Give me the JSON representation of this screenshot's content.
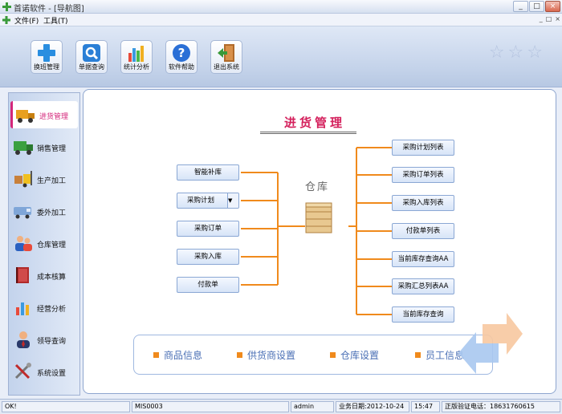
{
  "window": {
    "title": "首诺软件 - [导航图]",
    "minimize": "_",
    "maximize": "□",
    "close": "×"
  },
  "menubar": {
    "file": "文件(F)",
    "tools": "工具(T)",
    "mdi_buttons": [
      "_",
      "□",
      "×"
    ]
  },
  "toolbar": {
    "items": [
      {
        "label": "换班管理",
        "icon": "plus-icon"
      },
      {
        "label": "单据查询",
        "icon": "magnifier-icon"
      },
      {
        "label": "统计分析",
        "icon": "bar-chart-icon"
      },
      {
        "label": "软件帮助",
        "icon": "help-icon"
      },
      {
        "label": "退出系统",
        "icon": "exit-door-icon"
      }
    ]
  },
  "nav": {
    "items": [
      {
        "label": "进货管理",
        "icon": "truck-icon",
        "active": true
      },
      {
        "label": "销售管理",
        "icon": "delivery-truck-icon"
      },
      {
        "label": "生产加工",
        "icon": "forklift-icon"
      },
      {
        "label": "委外加工",
        "icon": "van-icon"
      },
      {
        "label": "仓库管理",
        "icon": "users-icon"
      },
      {
        "label": "成本核算",
        "icon": "book-icon"
      },
      {
        "label": "经营分析",
        "icon": "analysis-chart-icon"
      },
      {
        "label": "领导查询",
        "icon": "manager-icon"
      },
      {
        "label": "系统设置",
        "icon": "tools-icon"
      }
    ]
  },
  "main": {
    "heading": "进货管理",
    "warehouse_label": "仓库",
    "left_boxes": [
      "智能补库",
      "采购计划",
      "采购订单",
      "采购入库",
      "付款单"
    ],
    "right_boxes": [
      "采购计划列表",
      "采购订单列表",
      "采购入库列表",
      "付款单列表",
      "当前库存查询AA",
      "采购汇总列表AA",
      "当前库存查询"
    ],
    "quick_links": [
      "商品信息",
      "供货商设置",
      "仓库设置",
      "员工信息"
    ],
    "colors": {
      "accent": "#f08a1c",
      "heading": "#d4205c",
      "link": "#4a6fb5"
    }
  },
  "status": {
    "ok": "OK!",
    "code": "MIS0003",
    "user": "admin",
    "business_date": "业务日期:2012-10-24",
    "time": "15:47",
    "phone": "正版验证电话：18631760615"
  }
}
